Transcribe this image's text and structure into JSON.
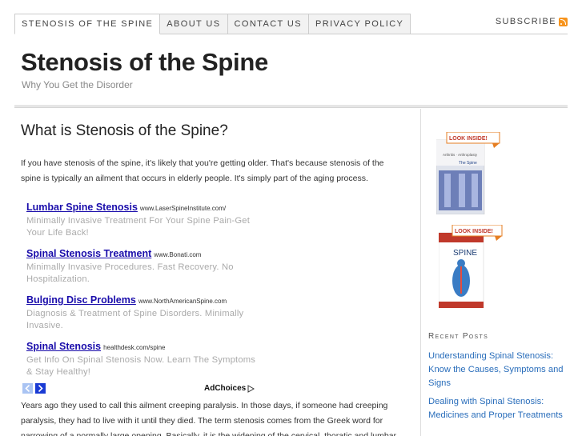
{
  "nav": {
    "tabs": [
      "STENOSIS OF THE SPINE",
      "ABOUT US",
      "CONTACT US",
      "PRIVACY POLICY"
    ],
    "subscribe_label": "SUBSCRIBE"
  },
  "header": {
    "title": "Stenosis of the Spine",
    "description": "Why You Get the Disorder"
  },
  "post": {
    "title": "What is Stenosis of the Spine?",
    "intro": "If you have stenosis of the spine, it's likely that you're getting older. That's because stenosis of the spine is typically an ailment that occurs in elderly people. It's simply part of the aging process.",
    "body": "Years ago they used to call this ailment creeping paralysis. In those days, if someone had creeping paralysis, they had to live with it until they died. The term stenosis comes from the Greek word for narrowing of a normally large opening. Basically, it is the widening of the cervical, thoratic and lumbar"
  },
  "ads": {
    "items": [
      {
        "title": "Lumbar Spine Stenosis",
        "url": "www.LaserSpineInstitute.com/",
        "desc": "Minimally Invasive Treatment For Your Spine Pain-Get Your Life Back!"
      },
      {
        "title": "Spinal Stenosis Treatment",
        "url": "www.Bonati.com",
        "desc": "Minimally Invasive Procedures. Fast Recovery. No Hospitalization."
      },
      {
        "title": "Bulging Disc Problems",
        "url": "www.NorthAmericanSpine.com",
        "desc": "Diagnosis & Treatment of Spine Disorders. Minimally Invasive."
      },
      {
        "title": "Spinal Stenosis",
        "url": "healthdesk.com/spine",
        "desc": "Get Info On Spinal Stenosis Now. Learn The Symptoms & Stay Healthy!"
      }
    ],
    "adchoices_label": "AdChoices"
  },
  "sidebar": {
    "book1": {
      "badge": "LOOK INSIDE!",
      "subtitle": "Arthritis · Arthroplasty",
      "title": "The Spine"
    },
    "book2": {
      "badge": "LOOK INSIDE!",
      "title": "SPINE"
    },
    "recent_heading": "Recent Posts",
    "recent_posts": [
      "Understanding Spinal Stenosis: Know the Causes, Symptoms and Signs",
      "Dealing with Spinal Stenosis: Medicines and Proper Treatments"
    ]
  },
  "colors": {
    "link": "#2a6ebb",
    "ad_title": "#1a0dab",
    "rss": "#f7941d"
  }
}
